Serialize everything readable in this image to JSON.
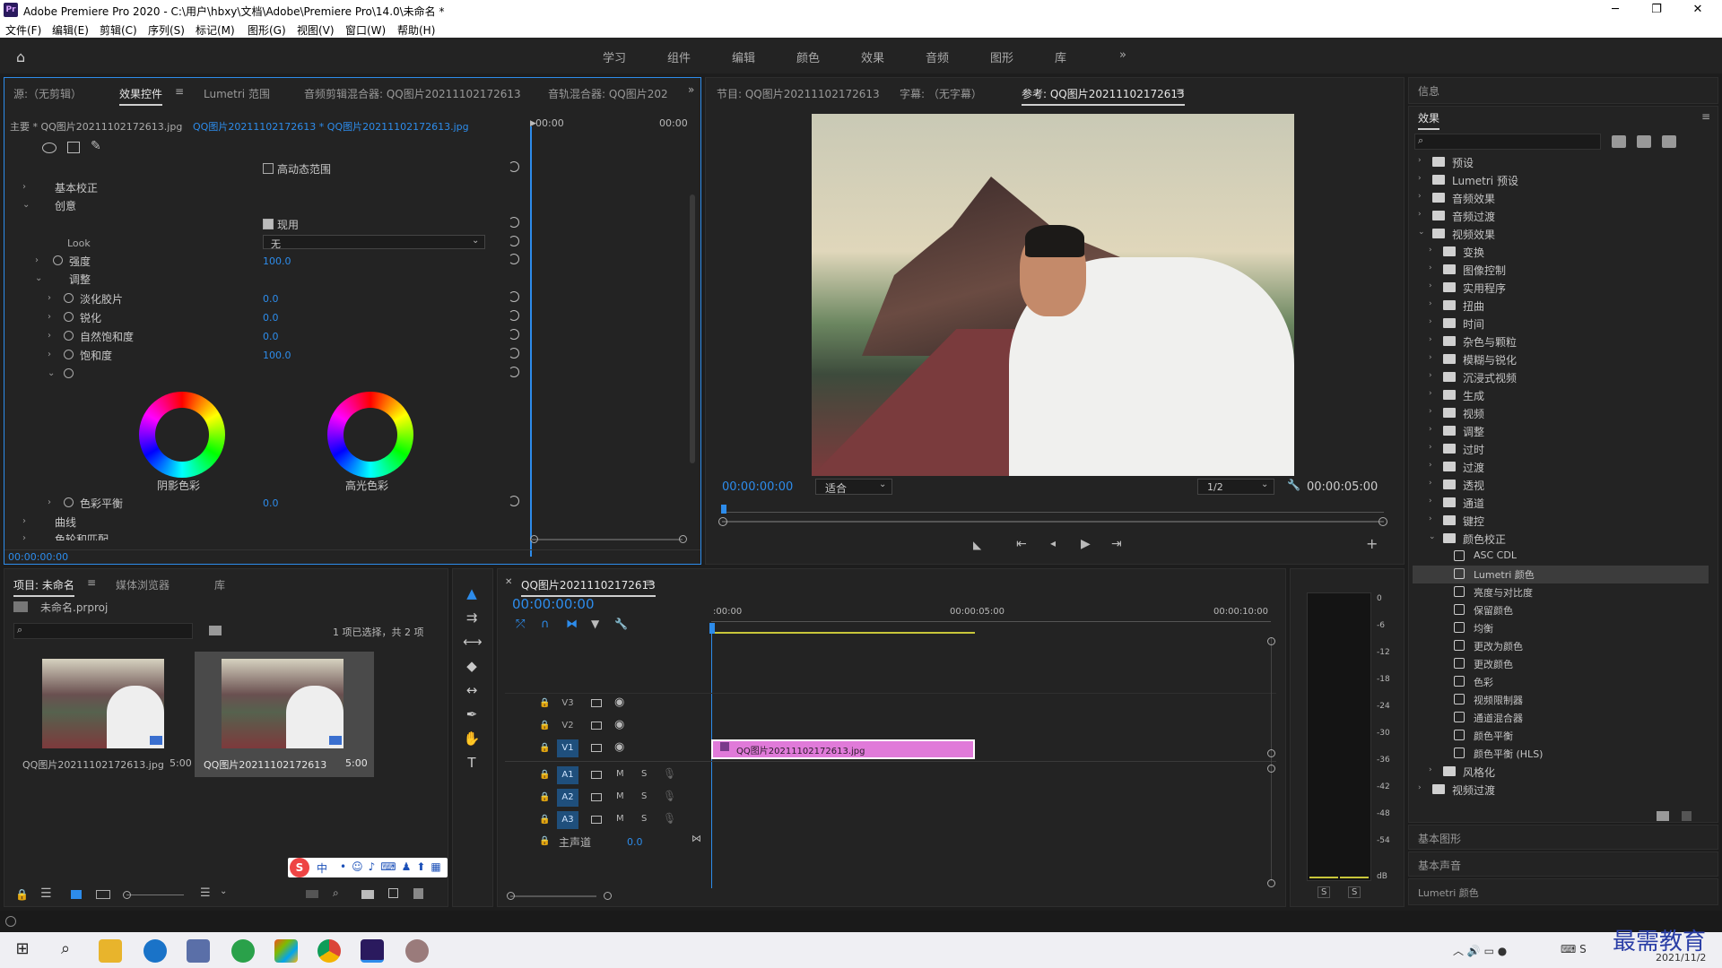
{
  "app": {
    "title": "Adobe Premiere Pro 2020 - C:\\用户\\hbxy\\文档\\Adobe\\Premiere Pro\\14.0\\未命名 *",
    "logo": "Pr"
  },
  "menu": [
    "文件(F)",
    "编辑(E)",
    "剪辑(C)",
    "序列(S)",
    "标记(M)",
    "图形(G)",
    "视图(V)",
    "窗口(W)",
    "帮助(H)"
  ],
  "workspaces": [
    "学习",
    "组件",
    "编辑",
    "颜色",
    "效果",
    "音频",
    "图形",
    "库"
  ],
  "source_panel": {
    "tabs": [
      "源:（无剪辑）",
      "效果控件",
      "Lumetri 范围",
      "音频剪辑混合器: QQ图片20211102172613",
      "音轨混合器: QQ图片202"
    ],
    "master": "主要 * QQ图片20211102172613.jpg",
    "clip": "QQ图片20211102172613 * QQ图片20211102172613.jpg",
    "time_start": "00:00",
    "time_end": "00:00",
    "hdr_label": "高动态范围",
    "basic": "基本校正",
    "creative": "创意",
    "enable": "现用",
    "look_label": "Look",
    "look_value": "无",
    "intensity": {
      "label": "强度",
      "value": "100.0"
    },
    "adjust": "调整",
    "params": [
      {
        "label": "淡化胶片",
        "value": "0.0"
      },
      {
        "label": "锐化",
        "value": "0.0"
      },
      {
        "label": "自然饱和度",
        "value": "0.0"
      },
      {
        "label": "饱和度",
        "value": "100.0"
      }
    ],
    "shadow_tint": "阴影色彩",
    "highlight_tint": "高光色彩",
    "balance": {
      "label": "色彩平衡",
      "value": "0.0"
    },
    "curves": "曲线",
    "wheels": "色轮和匹配",
    "timecode": "00:00:00:00"
  },
  "program_panel": {
    "tabs": [
      "节目: QQ图片20211102172613",
      "字幕: （无字幕）",
      "参考: QQ图片20211102172613"
    ],
    "time": "00:00:00:00",
    "fit": "适合",
    "res": "1/2",
    "duration": "00:00:05:00"
  },
  "info_panel": {
    "title": "信息"
  },
  "effects_panel": {
    "title": "效果",
    "tree": [
      {
        "label": "预设",
        "level": 0,
        "type": "folder",
        "open": false
      },
      {
        "label": "Lumetri 预设",
        "level": 0,
        "type": "folder",
        "open": false
      },
      {
        "label": "音频效果",
        "level": 0,
        "type": "folder",
        "open": false
      },
      {
        "label": "音频过渡",
        "level": 0,
        "type": "folder",
        "open": false
      },
      {
        "label": "视频效果",
        "level": 0,
        "type": "folder",
        "open": true
      },
      {
        "label": "变换",
        "level": 1,
        "type": "folder",
        "open": false
      },
      {
        "label": "图像控制",
        "level": 1,
        "type": "folder",
        "open": false
      },
      {
        "label": "实用程序",
        "level": 1,
        "type": "folder",
        "open": false
      },
      {
        "label": "扭曲",
        "level": 1,
        "type": "folder",
        "open": false
      },
      {
        "label": "时间",
        "level": 1,
        "type": "folder",
        "open": false
      },
      {
        "label": "杂色与颗粒",
        "level": 1,
        "type": "folder",
        "open": false
      },
      {
        "label": "模糊与锐化",
        "level": 1,
        "type": "folder",
        "open": false
      },
      {
        "label": "沉浸式视频",
        "level": 1,
        "type": "folder",
        "open": false
      },
      {
        "label": "生成",
        "level": 1,
        "type": "folder",
        "open": false
      },
      {
        "label": "视频",
        "level": 1,
        "type": "folder",
        "open": false
      },
      {
        "label": "调整",
        "level": 1,
        "type": "folder",
        "open": false
      },
      {
        "label": "过时",
        "level": 1,
        "type": "folder",
        "open": false
      },
      {
        "label": "过渡",
        "level": 1,
        "type": "folder",
        "open": false
      },
      {
        "label": "透视",
        "level": 1,
        "type": "folder",
        "open": false
      },
      {
        "label": "通道",
        "level": 1,
        "type": "folder",
        "open": false
      },
      {
        "label": "键控",
        "level": 1,
        "type": "folder",
        "open": false
      },
      {
        "label": "颜色校正",
        "level": 1,
        "type": "folder",
        "open": true
      },
      {
        "label": "ASC CDL",
        "level": 2,
        "type": "fx"
      },
      {
        "label": "Lumetri 颜色",
        "level": 2,
        "type": "fx",
        "selected": true
      },
      {
        "label": "亮度与对比度",
        "level": 2,
        "type": "fx"
      },
      {
        "label": "保留颜色",
        "level": 2,
        "type": "fx"
      },
      {
        "label": "均衡",
        "level": 2,
        "type": "fx"
      },
      {
        "label": "更改为颜色",
        "level": 2,
        "type": "fx"
      },
      {
        "label": "更改颜色",
        "level": 2,
        "type": "fx"
      },
      {
        "label": "色彩",
        "level": 2,
        "type": "fx"
      },
      {
        "label": "视频限制器",
        "level": 2,
        "type": "fx"
      },
      {
        "label": "通道混合器",
        "level": 2,
        "type": "fx"
      },
      {
        "label": "颜色平衡",
        "level": 2,
        "type": "fx"
      },
      {
        "label": "颜色平衡 (HLS)",
        "level": 2,
        "type": "fx"
      },
      {
        "label": "风格化",
        "level": 1,
        "type": "folder",
        "open": false
      },
      {
        "label": "视频过渡",
        "level": 0,
        "type": "folder",
        "open": false
      }
    ],
    "bottom": [
      "基本图形",
      "基本声音",
      "Lumetri 颜色"
    ]
  },
  "project_panel": {
    "tabs": [
      "项目: 未命名",
      "媒体浏览器",
      "库"
    ],
    "file": "未命名.prproj",
    "selection": "1 项已选择，共 2 项",
    "items": [
      {
        "name": "QQ图片20211102172613.jpg",
        "dur": "5:00"
      },
      {
        "name": "QQ图片20211102172613",
        "dur": "5:00"
      }
    ]
  },
  "timeline": {
    "tab": "QQ图片20211102172613",
    "time": "00:00:00:00",
    "ruler": [
      ":00:00",
      "00:00:05:00",
      "00:00:10:00"
    ],
    "video_tracks": [
      "V3",
      "V2",
      "V1"
    ],
    "audio_tracks": [
      "A1",
      "A2",
      "A3"
    ],
    "mix_label": "主声道",
    "mix_value": "0.0",
    "m": "M",
    "s": "S",
    "clip": "QQ图片20211102172613.jpg"
  },
  "meter": {
    "scale": [
      "0",
      "-6",
      "-12",
      "-18",
      "-24",
      "-30",
      "-36",
      "-42",
      "-48",
      "-54",
      "dB"
    ],
    "s_labels": [
      "S",
      "S"
    ]
  },
  "ime": {
    "label": "中"
  },
  "watermark": {
    "text": "最需教育",
    "date": "2021/11/2"
  },
  "colors": {
    "accent": "#2d8ceb",
    "clip": "#e07ad9",
    "playhead": "#2d8ceb"
  }
}
